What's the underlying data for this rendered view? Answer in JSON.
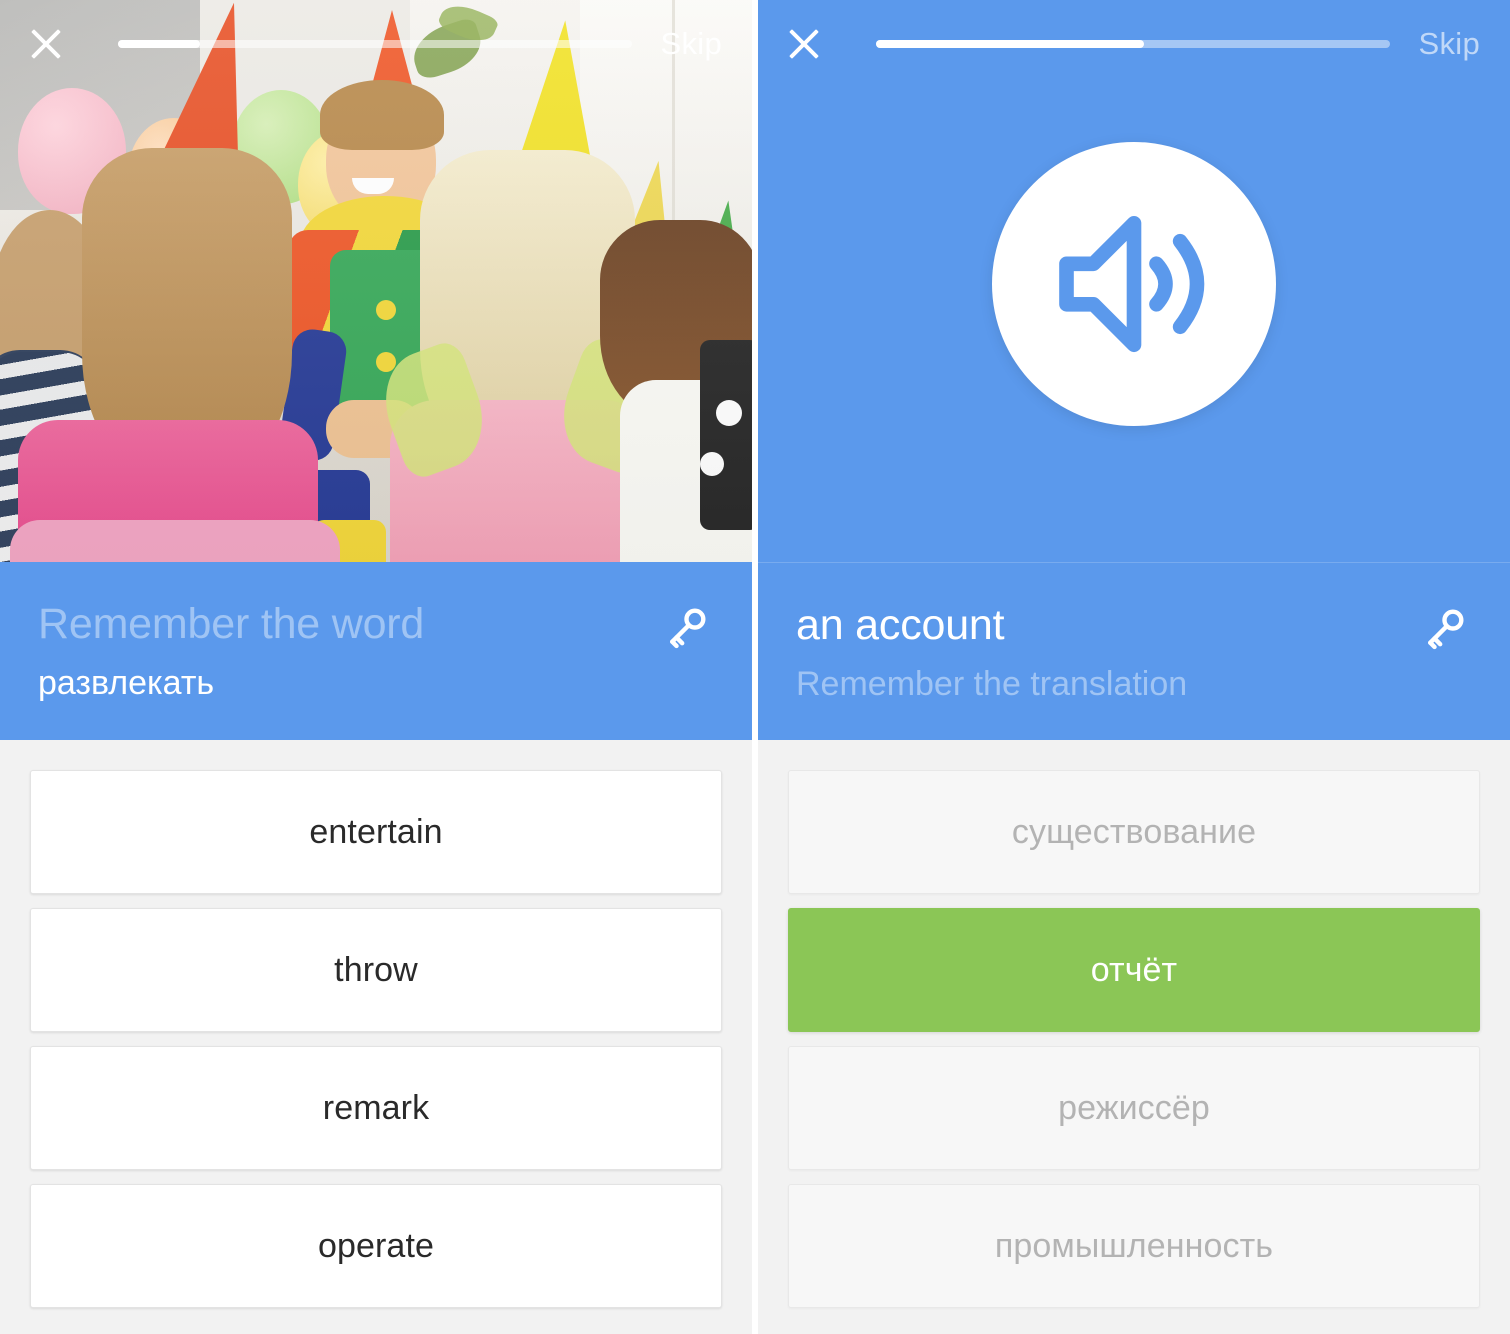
{
  "screen": {
    "app_kind": "vocabulary-flashcard-quiz",
    "panel_count": 2
  },
  "left": {
    "topbar": {
      "close_icon": "close-icon",
      "skip_label": "Skip",
      "progress_percent": 16
    },
    "illustration": {
      "icon": "party-photo",
      "alt": "clown entertaining children at a birthday party with balloons and party hats"
    },
    "header": {
      "title": "Remember the word",
      "title_style": "dim",
      "subtitle": "развлекать",
      "subtitle_style": "solid",
      "key_icon": "key-icon"
    },
    "options": [
      {
        "label": "entertain",
        "state": "white"
      },
      {
        "label": "throw",
        "state": "white"
      },
      {
        "label": "remark",
        "state": "white"
      },
      {
        "label": "operate",
        "state": "white"
      }
    ]
  },
  "right": {
    "topbar": {
      "close_icon": "close-icon",
      "skip_label": "Skip",
      "progress_percent": 52
    },
    "audio": {
      "icon": "speaker-volume-icon",
      "circle_color": "#ffffff",
      "icon_color": "#5b99ec"
    },
    "header": {
      "title": "an account",
      "title_style": "solid",
      "subtitle": "Remember the translation",
      "subtitle_style": "dim",
      "key_icon": "key-icon"
    },
    "options": [
      {
        "label": "существование",
        "state": "faded"
      },
      {
        "label": "отчёт",
        "state": "correct"
      },
      {
        "label": "режиссёр",
        "state": "faded"
      },
      {
        "label": "промышленность",
        "state": "faded"
      }
    ]
  },
  "colors": {
    "brand_blue": "#5b99ec",
    "correct_green": "#8bc656",
    "page_bg": "#f2f2f2",
    "card_white": "#ffffff",
    "faded_text": "#b3b3b3"
  }
}
